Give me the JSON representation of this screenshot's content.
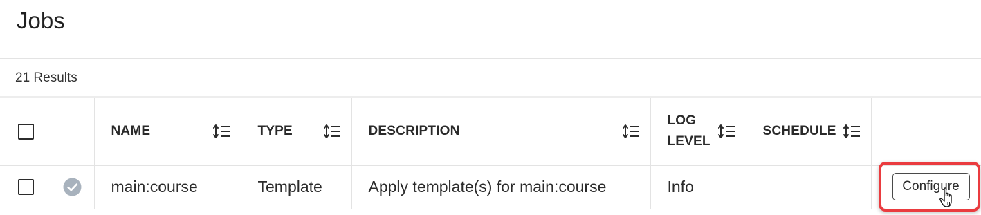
{
  "page": {
    "title": "Jobs",
    "results_label": "21 Results"
  },
  "table": {
    "columns": [
      {
        "key": "select",
        "label": ""
      },
      {
        "key": "status",
        "label": ""
      },
      {
        "key": "name",
        "label": "NAME",
        "sortable": true
      },
      {
        "key": "type",
        "label": "TYPE",
        "sortable": true
      },
      {
        "key": "description",
        "label": "DESCRIPTION",
        "sortable": true
      },
      {
        "key": "log_level",
        "label": "LOG LEVEL",
        "sortable": true
      },
      {
        "key": "schedule",
        "label": "SCHEDULE",
        "sortable": true
      },
      {
        "key": "actions",
        "label": ""
      }
    ],
    "header_labels": {
      "name": "NAME",
      "type": "TYPE",
      "description": "DESCRIPTION",
      "log_level_line1": "LOG",
      "log_level_line2": "LEVEL",
      "schedule": "SCHEDULE"
    },
    "rows": [
      {
        "selected": false,
        "status_icon": "check-circle-icon",
        "name": "main:course",
        "type": "Template",
        "description": "Apply template(s) for main:course",
        "log_level": "Info",
        "schedule": "",
        "action_label": "Configure"
      }
    ]
  },
  "colors": {
    "highlight": "#ea3b3f",
    "status_icon": "#a8b2bd",
    "divider": "#e3e3e3"
  },
  "icons": {
    "sort": "sort-icon",
    "status": "check-circle-icon",
    "cursor": "hand-pointer-icon"
  }
}
